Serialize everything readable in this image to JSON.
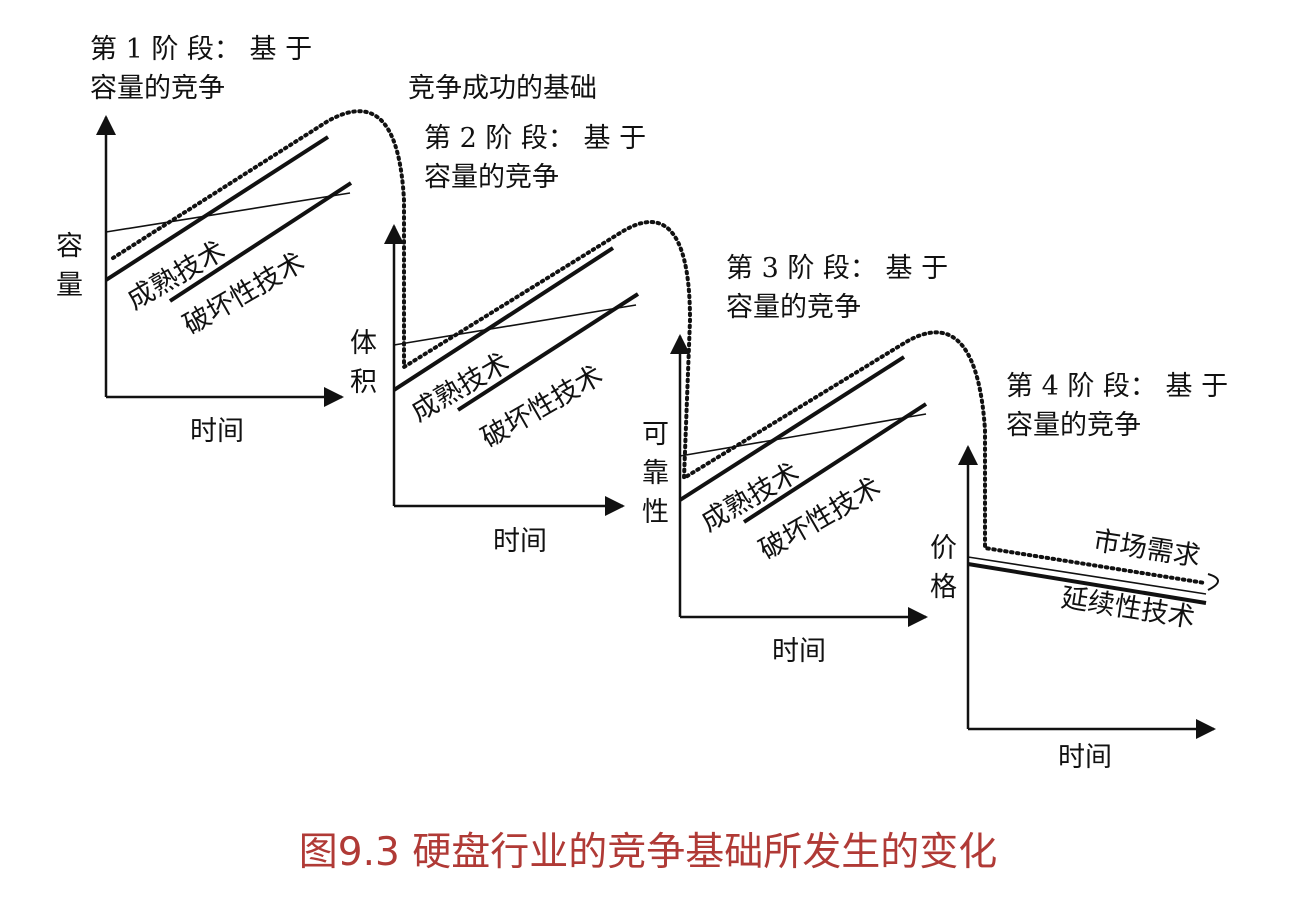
{
  "caption": "图9.3 硬盘行业的竞争基础所发生的变化",
  "frontier_label": "竞争成功的基础",
  "x_axis_label": "时间",
  "mature_tech_label": "成熟技术",
  "disruptive_tech_label": "破坏性技术",
  "stages": [
    {
      "title_line1": "第 1 阶 段：  基  于",
      "title_line2": "容量的竞争",
      "y_axis_label": [
        "容",
        "量"
      ]
    },
    {
      "title_line1": "第 2 阶 段：  基  于",
      "title_line2": "容量的竞争",
      "y_axis_label": [
        "体",
        "积"
      ]
    },
    {
      "title_line1": "第 3 阶 段：  基  于",
      "title_line2": "容量的竞争",
      "y_axis_label": [
        "可",
        "靠",
        "性"
      ]
    },
    {
      "title_line1": "第 4 阶 段：  基  于",
      "title_line2": "容量的竞争",
      "y_axis_label": [
        "价",
        "格"
      ]
    }
  ],
  "stage4_curves": {
    "market_demand_label": "市场需求",
    "sustaining_tech_label": "延续性技术"
  },
  "colors": {
    "ink": "#111111",
    "caption": "#b03a36"
  }
}
